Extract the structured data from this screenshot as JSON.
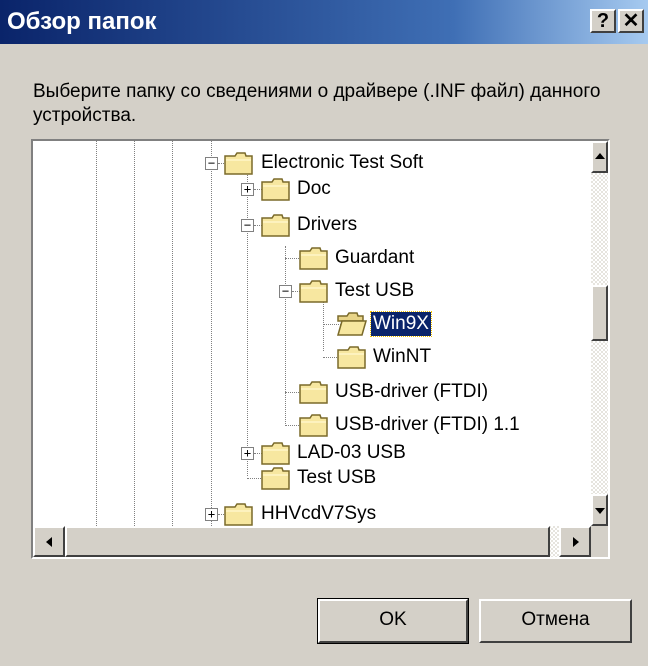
{
  "window": {
    "title": "Обзор папок",
    "help_label": "?",
    "close_label": "✕"
  },
  "instruction": "Выберите папку со сведениями о драйвере (.INF файл) данного устройства.",
  "tree": {
    "expand_glyph": "+",
    "collapse_glyph": "−",
    "nodes": [
      {
        "label": "Electronic Test Soft",
        "state": "expanded",
        "icon": "folder-icon"
      },
      {
        "label": "Doc",
        "state": "collapsed",
        "icon": "folder-icon"
      },
      {
        "label": "Drivers",
        "state": "expanded",
        "icon": "folder-icon"
      },
      {
        "label": "Guardant",
        "state": "leaf",
        "icon": "folder-icon"
      },
      {
        "label": "Test USB",
        "state": "expanded",
        "icon": "folder-icon"
      },
      {
        "label": "Win9X",
        "state": "leaf",
        "selected": true,
        "icon": "open-folder-icon"
      },
      {
        "label": "WinNT",
        "state": "leaf",
        "icon": "folder-icon"
      },
      {
        "label": "USB-driver (FTDI)",
        "state": "leaf",
        "icon": "folder-icon"
      },
      {
        "label": "USB-driver (FTDI) 1.1",
        "state": "leaf",
        "icon": "folder-icon"
      },
      {
        "label": "LAD-03 USB",
        "state": "collapsed",
        "icon": "folder-icon"
      },
      {
        "label": "Test USB",
        "state": "leaf",
        "icon": "folder-icon"
      },
      {
        "label": "HHVcdV7Sys",
        "state": "collapsed",
        "icon": "folder-icon"
      }
    ]
  },
  "buttons": {
    "ok_label": "OK",
    "cancel_label": "Отмена"
  },
  "colors": {
    "title_bar": "#0a246a",
    "selection": "#0a246a",
    "face": "#d4d0c8"
  }
}
